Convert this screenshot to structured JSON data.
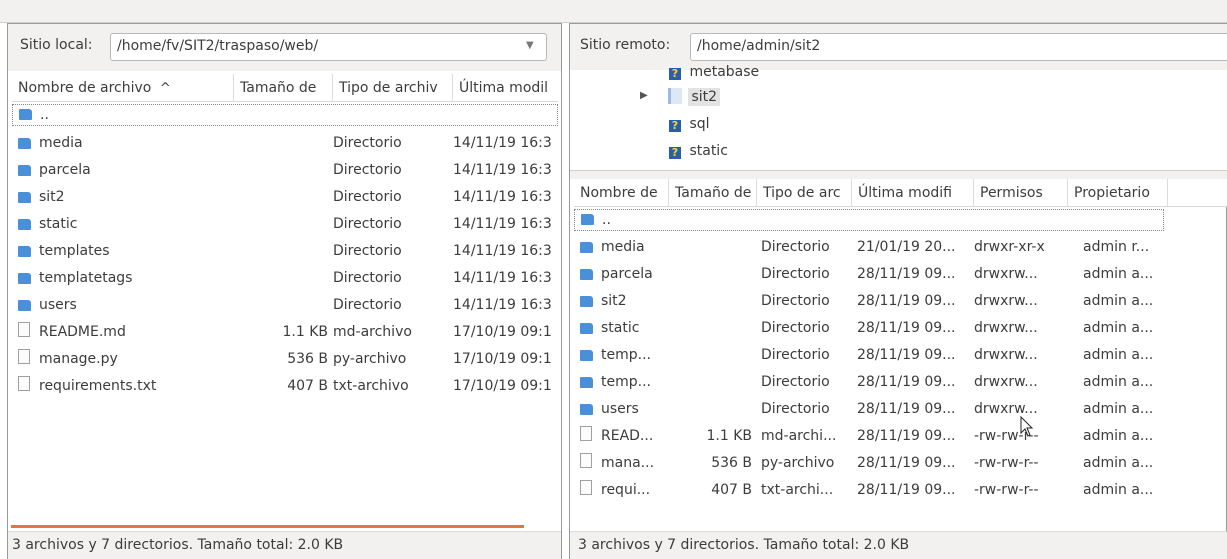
{
  "local": {
    "site_label": "Sitio local:",
    "path": "/home/fv/SIT2/traspaso/web/",
    "columns": [
      "Nombre de archivo",
      "Tamaño de",
      "Tipo de archiv",
      "Última modil"
    ],
    "sort_indicator": "^",
    "rows": [
      {
        "name": "..",
        "size": "",
        "type": "",
        "modified": "",
        "icon": "folder-icon"
      },
      {
        "name": "media",
        "size": "",
        "type": "Directorio",
        "modified": "14/11/19 16:3",
        "icon": "folder-icon"
      },
      {
        "name": "parcela",
        "size": "",
        "type": "Directorio",
        "modified": "14/11/19 16:3",
        "icon": "folder-icon"
      },
      {
        "name": "sit2",
        "size": "",
        "type": "Directorio",
        "modified": "14/11/19 16:3",
        "icon": "folder-icon"
      },
      {
        "name": "static",
        "size": "",
        "type": "Directorio",
        "modified": "14/11/19 16:3",
        "icon": "folder-icon"
      },
      {
        "name": "templates",
        "size": "",
        "type": "Directorio",
        "modified": "14/11/19 16:3",
        "icon": "folder-icon"
      },
      {
        "name": "templatetags",
        "size": "",
        "type": "Directorio",
        "modified": "14/11/19 16:3",
        "icon": "folder-icon"
      },
      {
        "name": "users",
        "size": "",
        "type": "Directorio",
        "modified": "14/11/19 16:3",
        "icon": "folder-icon"
      },
      {
        "name": "README.md",
        "size": "1.1 KB",
        "type": "md-archivo",
        "modified": "17/10/19 09:1",
        "icon": "file-icon"
      },
      {
        "name": "manage.py",
        "size": "536 B",
        "type": "py-archivo",
        "modified": "17/10/19 09:1",
        "icon": "file-icon"
      },
      {
        "name": "requirements.txt",
        "size": "407 B",
        "type": "txt-archivo",
        "modified": "17/10/19 09:1",
        "icon": "file-icon"
      }
    ],
    "status": "3 archivos y 7 directorios. Tamaño total: 2.0 KB"
  },
  "remote": {
    "site_label": "Sitio remoto:",
    "path": "/home/admin/sit2",
    "tree": [
      {
        "name": "metabase",
        "icon": "unknown-folder-icon"
      },
      {
        "name": "sit2",
        "icon": "folder-icon"
      },
      {
        "name": "sql",
        "icon": "unknown-folder-icon"
      },
      {
        "name": "static",
        "icon": "unknown-folder-icon"
      }
    ],
    "columns": [
      "Nombre de",
      "Tamaño de",
      "Tipo de arc",
      "Última modifi",
      "Permisos",
      "Propietario"
    ],
    "rows": [
      {
        "name": "..",
        "size": "",
        "type": "",
        "modified": "",
        "perms": "",
        "owner": "",
        "icon": "folder-icon"
      },
      {
        "name": "media",
        "size": "",
        "type": "Directorio",
        "modified": "21/01/19 20...",
        "perms": "drwxr-xr-x",
        "owner": "admin r...",
        "icon": "folder-icon"
      },
      {
        "name": "parcela",
        "size": "",
        "type": "Directorio",
        "modified": "28/11/19 09...",
        "perms": "drwxrw...",
        "owner": "admin a...",
        "icon": "folder-icon"
      },
      {
        "name": "sit2",
        "size": "",
        "type": "Directorio",
        "modified": "28/11/19 09...",
        "perms": "drwxrw...",
        "owner": "admin a...",
        "icon": "folder-icon"
      },
      {
        "name": "static",
        "size": "",
        "type": "Directorio",
        "modified": "28/11/19 09...",
        "perms": "drwxrw...",
        "owner": "admin a...",
        "icon": "folder-icon"
      },
      {
        "name": "temp...",
        "size": "",
        "type": "Directorio",
        "modified": "28/11/19 09...",
        "perms": "drwxrw...",
        "owner": "admin a...",
        "icon": "folder-icon"
      },
      {
        "name": "temp...",
        "size": "",
        "type": "Directorio",
        "modified": "28/11/19 09...",
        "perms": "drwxrw...",
        "owner": "admin a...",
        "icon": "folder-icon"
      },
      {
        "name": "users",
        "size": "",
        "type": "Directorio",
        "modified": "28/11/19 09...",
        "perms": "drwxrw...",
        "owner": "admin a...",
        "icon": "folder-icon"
      },
      {
        "name": "READ...",
        "size": "1.1 KB",
        "type": "md-archi...",
        "modified": "28/11/19 09...",
        "perms": "-rw-rw-r--",
        "owner": "admin a...",
        "icon": "file-icon"
      },
      {
        "name": "mana...",
        "size": "536 B",
        "type": "py-archivo",
        "modified": "28/11/19 09...",
        "perms": "-rw-rw-r--",
        "owner": "admin a...",
        "icon": "file-icon"
      },
      {
        "name": "requi...",
        "size": "407 B",
        "type": "txt-archi...",
        "modified": "28/11/19 09...",
        "perms": "-rw-rw-r--",
        "owner": "admin a...",
        "icon": "file-icon"
      }
    ],
    "status": "3 archivos y 7 directorios. Tamaño total: 2.0 KB"
  },
  "colors": {
    "folder": "#4a90d9",
    "progress": "#e9743b"
  }
}
